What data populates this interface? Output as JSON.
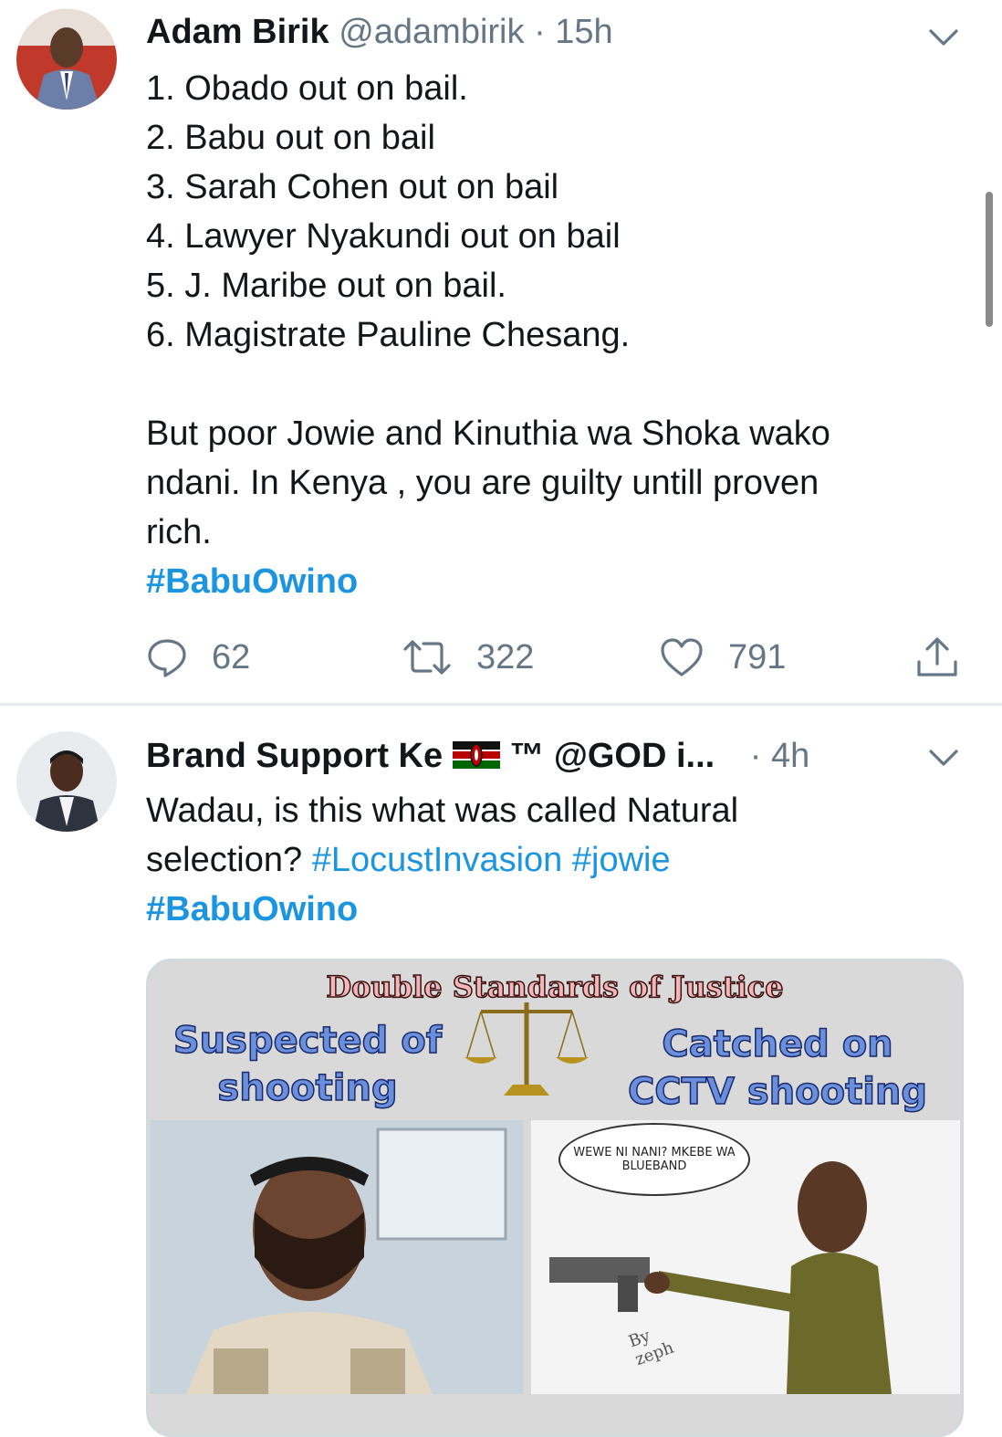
{
  "tweets": [
    {
      "name": "Adam Birik",
      "handle": "@adambirik",
      "sep": "·",
      "time": "15h",
      "lines": [
        "1. Obado out on bail.",
        "2. Babu out on bail",
        "3. Sarah Cohen out on bail",
        "4. Lawyer Nyakundi out on bail",
        "5. J. Maribe out on bail.",
        "6. Magistrate Pauline Chesang.",
        "",
        "But poor Jowie and Kinuthia wa Shoka wako",
        "ndani. In Kenya , you are guilty untill proven",
        "rich."
      ],
      "hashtag": "#BabuOwino",
      "replies": "62",
      "retweets": "322",
      "likes": "791"
    },
    {
      "name": "Brand Support Ke",
      "tm": "™",
      "handle": "@GOD i...",
      "sep": "·",
      "time": "4h",
      "line1": "Wadau, is this what was called Natural",
      "line2_text": "selection?",
      "tag1": "#LocustInvasion",
      "tag2": "#jowie",
      "hashtag": "#BabuOwino",
      "media": {
        "title": "Double Standards of Justice",
        "left_caption_1": "Suspected of",
        "left_caption_2": "shooting",
        "right_caption_1": "Catched on",
        "right_caption_2": "CCTV shooting",
        "bubble": "WEWE NI NANI? MKEBE WA BLUEBAND",
        "signature_1": "By",
        "signature_2": "zeph"
      }
    }
  ],
  "icons": {
    "reply": "reply-icon",
    "retweet": "retweet-icon",
    "like": "heart-icon",
    "share": "share-icon",
    "menu": "chevron-down-icon"
  },
  "colors": {
    "link": "#1b95e0",
    "muted": "#657786"
  }
}
